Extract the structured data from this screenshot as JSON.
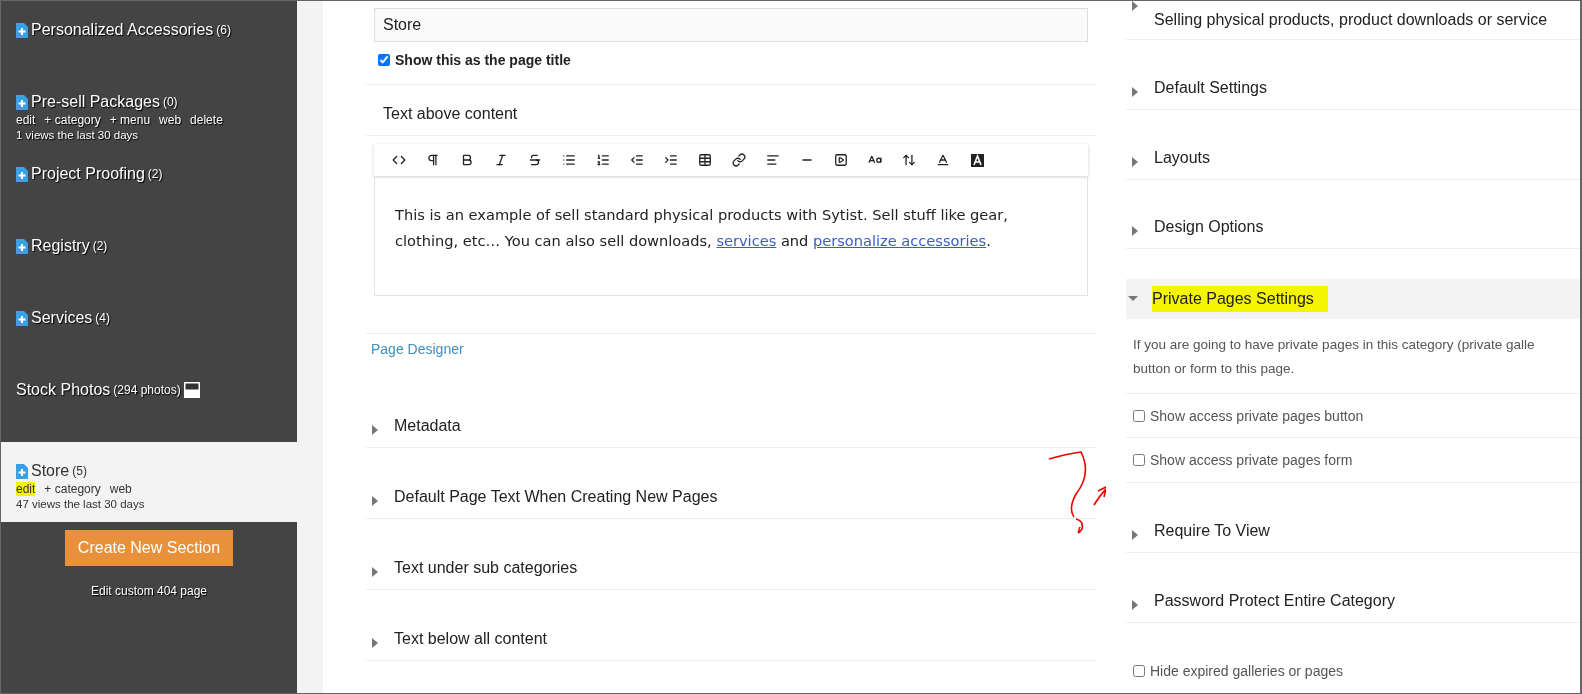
{
  "sidebar": {
    "sections": [
      {
        "kind": "category",
        "name": "Personalized Accessories",
        "count": "(6)",
        "selected": false
      },
      {
        "kind": "category",
        "name": "Pre-sell Packages",
        "count": "(0)",
        "selected": false,
        "links": [
          {
            "label": "edit",
            "highlighted": false
          },
          {
            "label": "+ category",
            "highlighted": false
          },
          {
            "label": "+ menu",
            "highlighted": false
          },
          {
            "label": "web",
            "highlighted": false
          },
          {
            "label": "delete",
            "highlighted": false
          }
        ],
        "views": "1 views the last 30 days"
      },
      {
        "kind": "category",
        "name": "Project Proofing",
        "count": "(2)",
        "selected": false
      },
      {
        "kind": "category",
        "name": "Registry",
        "count": "(2)",
        "selected": false
      },
      {
        "kind": "category",
        "name": "Services",
        "count": "(4)",
        "selected": false
      },
      {
        "kind": "photos",
        "name": "Stock Photos",
        "count": "(294 photos)",
        "selected": false
      },
      {
        "kind": "category",
        "name": "Store",
        "count": "(5)",
        "selected": true,
        "links": [
          {
            "label": "edit",
            "highlighted": true
          },
          {
            "label": "+ category",
            "highlighted": false
          },
          {
            "label": "web",
            "highlighted": false
          }
        ],
        "views": "47 views the last 30 days"
      }
    ],
    "create_button": "Create New Section",
    "footer_link": "Edit custom 404 page"
  },
  "main": {
    "section_name": {
      "value": "Store"
    },
    "show_title": {
      "label": "Show this as the page title",
      "checked": true
    },
    "text_above": {
      "label": "Text above content",
      "body": [
        {
          "text": "This is an example of sell standard physical products with Sytist. Sell stuff like gear, clothing, etc… You can also sell downloads, ",
          "link": false
        },
        {
          "text": "services",
          "link": true
        },
        {
          "text": " and ",
          "link": false
        },
        {
          "text": "personalize accessories",
          "link": true
        },
        {
          "text": ".",
          "link": false
        }
      ]
    },
    "page_designer": "Page Designer",
    "sections": [
      {
        "title": "Metadata",
        "expanded": false
      },
      {
        "title": "Default Page Text When Creating New Pages",
        "expanded": false
      },
      {
        "title": "Text under sub categories",
        "expanded": false
      },
      {
        "title": "Text below all content",
        "expanded": false
      }
    ]
  },
  "settings": {
    "sections": [
      {
        "title": "Selling physical products, product downloads or service",
        "expanded": false,
        "highlighted": false
      },
      {
        "title": "Default Settings",
        "expanded": false,
        "highlighted": false
      },
      {
        "title": "Layouts",
        "expanded": false,
        "highlighted": false
      },
      {
        "title": "Design Options",
        "expanded": false,
        "highlighted": false
      },
      {
        "title": "Private Pages Settings",
        "expanded": true,
        "highlighted": true,
        "description": "If you are going to have private pages in this category (private galle button or form to this page.",
        "options": [
          {
            "label": "Show access private pages button",
            "checked": false
          },
          {
            "label": "Show access private pages form",
            "checked": false
          }
        ]
      },
      {
        "title": "Require To View",
        "expanded": false,
        "highlighted": false
      },
      {
        "title": "Password Protect Entire Category",
        "expanded": false,
        "highlighted": false
      }
    ],
    "extra_options": [
      {
        "label": "Hide expired galleries or pages",
        "checked": false
      }
    ]
  }
}
